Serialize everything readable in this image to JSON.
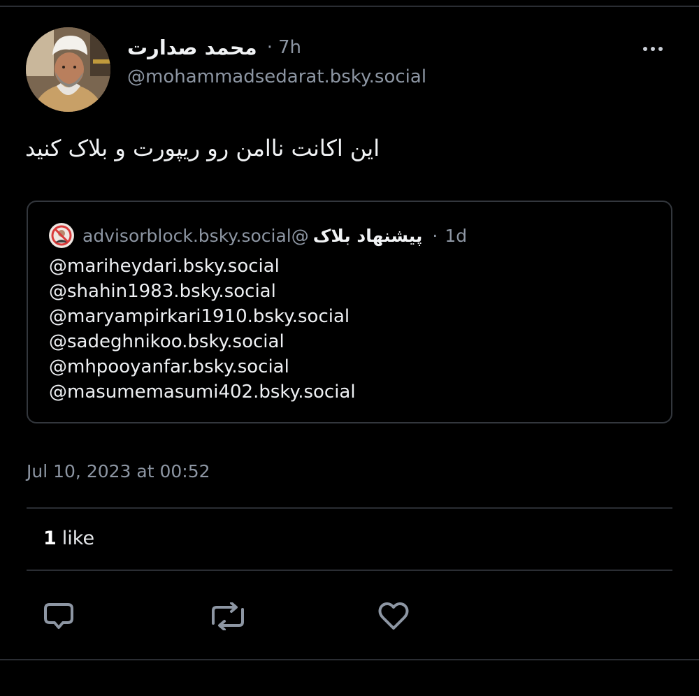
{
  "post": {
    "display_name": "محمد صدارت",
    "separator": "·",
    "age": "7h",
    "handle": "@mohammadsedarat.bsky.social",
    "text": "این اکانت ناامن رو ریپورت و بلاک کنید",
    "timestamp": "Jul 10, 2023 at 00:52"
  },
  "quote": {
    "handle": "advisorblock.bsky.social@",
    "display_name": "پیشنهاد بلاک",
    "separator": "·",
    "age": "1d",
    "lines": [
      "@mariheydari.bsky.social",
      "@shahin1983.bsky.social",
      "@maryampirkari1910.bsky.social",
      "@sadeghnikoo.bsky.social",
      "@mhpooyanfar.bsky.social",
      "@masumemasumi402.bsky.social"
    ]
  },
  "stats": {
    "like_count": "1",
    "like_label": "like"
  },
  "icons": {
    "more": "more-horizontal-icon",
    "reply": "reply-icon",
    "repost": "repost-icon",
    "like": "heart-icon",
    "quote_avatar": "no-entry-face-icon"
  },
  "colors": {
    "background": "#000000",
    "muted_text": "#8d96a3",
    "icon": "#8d96a3",
    "divider": "#2a2d33"
  }
}
